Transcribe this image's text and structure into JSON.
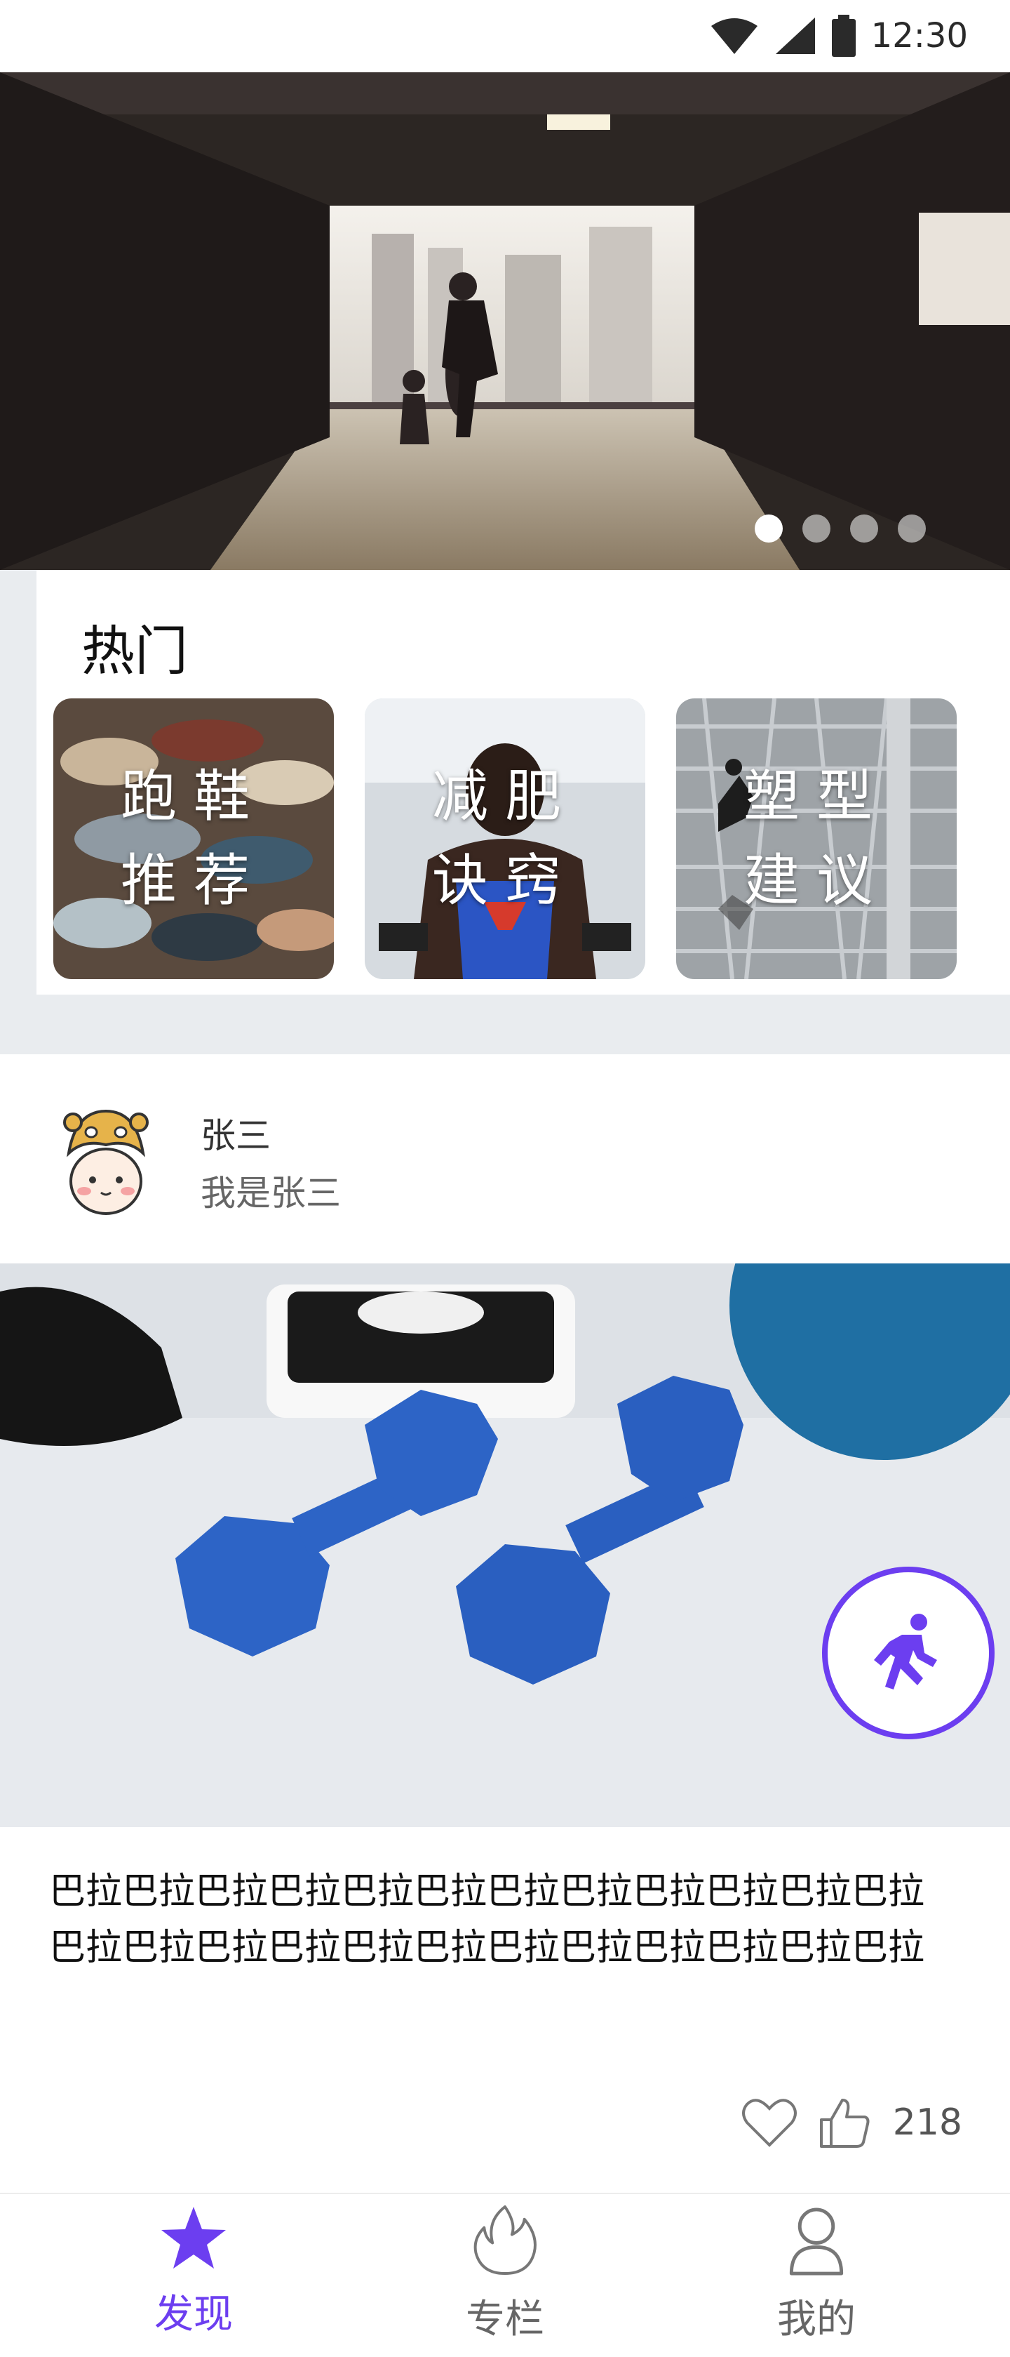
{
  "status_bar": {
    "time": "12:30"
  },
  "banner": {
    "dots": 4,
    "active_dot": 1
  },
  "hot": {
    "title": "热门",
    "items": [
      {
        "label": "跑鞋\n推荐"
      },
      {
        "label": "减肥\n诀窍"
      },
      {
        "label": "塑型\n建议"
      }
    ]
  },
  "post": {
    "user": {
      "name": "张三",
      "bio": "我是张三"
    },
    "text": "巴拉巴拉巴拉巴拉巴拉巴拉巴拉巴拉巴拉巴拉巴拉巴拉巴拉巴拉巴拉巴拉巴拉巴拉巴拉巴拉巴拉巴拉巴拉巴拉",
    "like_count": "218"
  },
  "nav": {
    "items": [
      {
        "label": "发现",
        "active": true
      },
      {
        "label": "专栏",
        "active": false
      },
      {
        "label": "我的",
        "active": false
      }
    ]
  },
  "colors": {
    "accent": "#6c3ef0",
    "inactive": "#666666"
  }
}
